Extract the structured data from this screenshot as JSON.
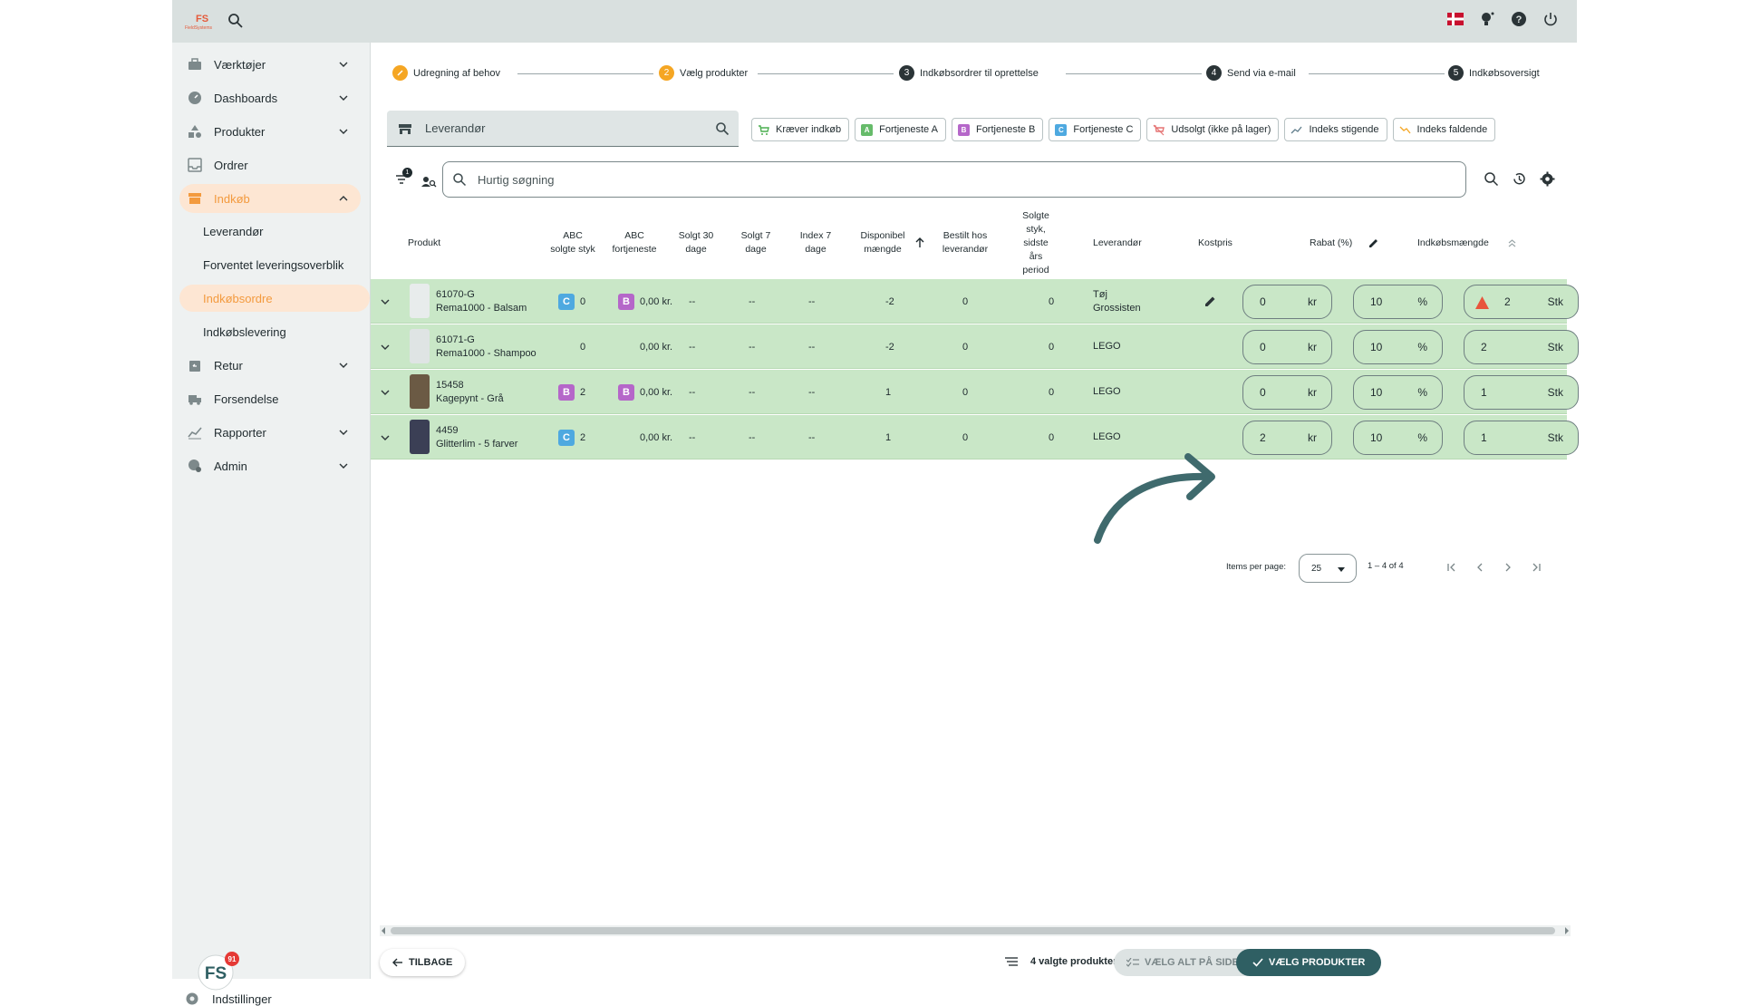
{
  "topbar": {
    "logo_text": "FieldSystems",
    "icons": [
      "search-icon",
      "danish-flag-icon",
      "lightbulb-icon",
      "help-icon",
      "power-icon"
    ]
  },
  "sidebar": {
    "items": [
      {
        "label": "Værktøjer",
        "icon": "toolbox-icon",
        "expandable": true
      },
      {
        "label": "Dashboards",
        "icon": "gauge-icon",
        "expandable": true
      },
      {
        "label": "Produkter",
        "icon": "shapes-icon",
        "expandable": true
      },
      {
        "label": "Ordrer",
        "icon": "inbox-icon",
        "expandable": false
      },
      {
        "label": "Indkøb",
        "icon": "store-icon",
        "expandable": true,
        "active": true
      },
      {
        "label": "Retur",
        "icon": "return-icon",
        "expandable": true
      },
      {
        "label": "Forsendelse",
        "icon": "truck-icon",
        "expandable": false
      },
      {
        "label": "Rapporter",
        "icon": "chart-icon",
        "expandable": true
      },
      {
        "label": "Admin",
        "icon": "admin-icon",
        "expandable": true
      }
    ],
    "subitems": [
      {
        "label": "Leverandør"
      },
      {
        "label": "Forventet leveringsoverblik"
      },
      {
        "label": "Indkøbsordre",
        "active": true
      },
      {
        "label": "Indkøbslevering"
      }
    ],
    "badge_count": "91",
    "settings_label": "Indstillinger"
  },
  "stepper": {
    "steps": [
      {
        "num": "✓",
        "label": "Udregning af behov",
        "color": "#f5a623"
      },
      {
        "num": "2",
        "label": "Vælg produkter",
        "color": "#f5a623"
      },
      {
        "num": "3",
        "label": "Indkøbsordrer til oprettelse",
        "color": "#2b3437"
      },
      {
        "num": "4",
        "label": "Send via e-mail",
        "color": "#2b3437"
      },
      {
        "num": "5",
        "label": "Indkøbsoversigt",
        "color": "#2b3437"
      }
    ]
  },
  "supplier_field": {
    "placeholder": "Leverandør"
  },
  "chips": [
    {
      "label": "Kræver indkøb",
      "icon": "cart-icon",
      "icon_text": "",
      "color": "#4caf50"
    },
    {
      "label": "Fortjeneste A",
      "icon": "a-icon",
      "icon_text": "A",
      "color": "#66bb6a"
    },
    {
      "label": "Fortjeneste B",
      "icon": "b-icon",
      "icon_text": "B",
      "color": "#b567c9"
    },
    {
      "label": "Fortjeneste C",
      "icon": "c-icon",
      "icon_text": "C",
      "color": "#4ea9e0"
    },
    {
      "label": "Udsolgt (ikke på lager)",
      "icon": "cart-off-icon",
      "icon_text": "",
      "color": "#e57373"
    },
    {
      "label": "Indeks stigende",
      "icon": "trend-up-icon",
      "icon_text": "",
      "color": "#607d8b"
    },
    {
      "label": "Indeks faldende",
      "icon": "trend-down-icon",
      "icon_text": "",
      "color": "#f5a623"
    }
  ],
  "filter_badge": "1",
  "quick_search": {
    "placeholder": "Hurtig søgning"
  },
  "table": {
    "headers": {
      "produkt": "Produkt",
      "abc_solgte": "ABC solgte styk",
      "abc_fortjeneste": "ABC fortjeneste",
      "solgt30": "Solgt 30 dage",
      "solgt7": "Solgt 7 dage",
      "index7": "Index 7 dage",
      "disponibel": "Disponibel mængde",
      "bestilt": "Bestilt hos leverandør",
      "solgte_sidste": "Solgte styk, sidste års period",
      "leverandor": "Leverandør",
      "kostpris": "Kostpris",
      "rabat": "Rabat (%)",
      "indkobsmaengde": "Indkøbsmængde"
    },
    "rows": [
      {
        "sku": "61070-G",
        "name": "Rema1000 - Balsam",
        "abc_solgte_badge": "C",
        "abc_solgte": "0",
        "abc_fortjeneste_badge": "B",
        "abc_fortjeneste": "0,00 kr.",
        "solgt30": "--",
        "solgt7": "--",
        "index7": "--",
        "disponibel": "-2",
        "bestilt": "0",
        "solgte_sidste": "0",
        "leverandor": "Tøj Grossisten",
        "kostpris": "0",
        "kostpris_unit": "kr",
        "rabat": "10",
        "rabat_unit": "%",
        "maengde": "2",
        "maengde_unit": "Stk",
        "warning": true
      },
      {
        "sku": "61071-G",
        "name": "Rema1000 - Shampoo",
        "abc_solgte_badge": "",
        "abc_solgte": "0",
        "abc_fortjeneste_badge": "",
        "abc_fortjeneste": "0,00 kr.",
        "solgt30": "--",
        "solgt7": "--",
        "index7": "--",
        "disponibel": "-2",
        "bestilt": "0",
        "solgte_sidste": "0",
        "leverandor": "LEGO",
        "kostpris": "0",
        "kostpris_unit": "kr",
        "rabat": "10",
        "rabat_unit": "%",
        "maengde": "2",
        "maengde_unit": "Stk",
        "warning": false
      },
      {
        "sku": "15458",
        "name": "Kagepynt - Grå",
        "abc_solgte_badge": "B",
        "abc_solgte": "2",
        "abc_fortjeneste_badge": "B",
        "abc_fortjeneste": "0,00 kr.",
        "solgt30": "--",
        "solgt7": "--",
        "index7": "--",
        "disponibel": "1",
        "bestilt": "0",
        "solgte_sidste": "0",
        "leverandor": "LEGO",
        "kostpris": "0",
        "kostpris_unit": "kr",
        "rabat": "10",
        "rabat_unit": "%",
        "maengde": "1",
        "maengde_unit": "Stk",
        "warning": false
      },
      {
        "sku": "4459",
        "name": "Glitterlim - 5 farver",
        "abc_solgte_badge": "C",
        "abc_solgte": "2",
        "abc_fortjeneste_badge": "",
        "abc_fortjeneste": "0,00 kr.",
        "solgt30": "--",
        "solgt7": "--",
        "index7": "--",
        "disponibel": "1",
        "bestilt": "0",
        "solgte_sidste": "0",
        "leverandor": "LEGO",
        "kostpris": "2",
        "kostpris_unit": "kr",
        "rabat": "10",
        "rabat_unit": "%",
        "maengde": "1",
        "maengde_unit": "Stk",
        "warning": false
      }
    ]
  },
  "paginator": {
    "label": "Items per page:",
    "page_size": "25",
    "range": "1 – 4 of 4"
  },
  "footer": {
    "back_label": "TILBAGE",
    "selected_label": "4 valgte produkter",
    "select_all_label": "VÆLG ALT PÅ SIDEN",
    "choose_label": "VÆLG PRODUKTER"
  },
  "colors": {
    "accent": "#f39a3e",
    "row_bg": "#c9e7c7",
    "primary": "#2f5f63",
    "arrow": "#3f6a6d"
  }
}
